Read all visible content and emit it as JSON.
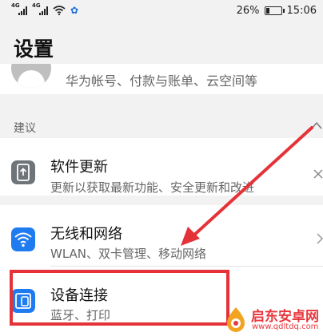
{
  "status_bar": {
    "sim1_label": "4G",
    "sim2_label": "4G",
    "battery_text": "26%",
    "battery_level": 0.26,
    "time": "15:06"
  },
  "page": {
    "title": "设置"
  },
  "account": {
    "subtitle": "华为帐号、付款与账单、云空间等"
  },
  "suggestions": {
    "section_label": "建议",
    "items": [
      {
        "title": "软件更新",
        "subtitle": "更新以获取最新功能、安全更新和改进",
        "icon": "software-update-icon"
      }
    ]
  },
  "settings": {
    "items": [
      {
        "title": "无线和网络",
        "subtitle": "WLAN、双卡管理、移动网络",
        "icon": "wifi-icon",
        "icon_color": "#1f7cf0"
      },
      {
        "title": "设备连接",
        "subtitle": "蓝牙、打印",
        "icon": "device-connection-icon",
        "icon_color": "#1f7cf0"
      }
    ]
  },
  "annotation": {
    "highlight_color": "#e53238"
  },
  "watermark": {
    "name": "启东安卓网",
    "url": "www.qdltdq.com"
  }
}
